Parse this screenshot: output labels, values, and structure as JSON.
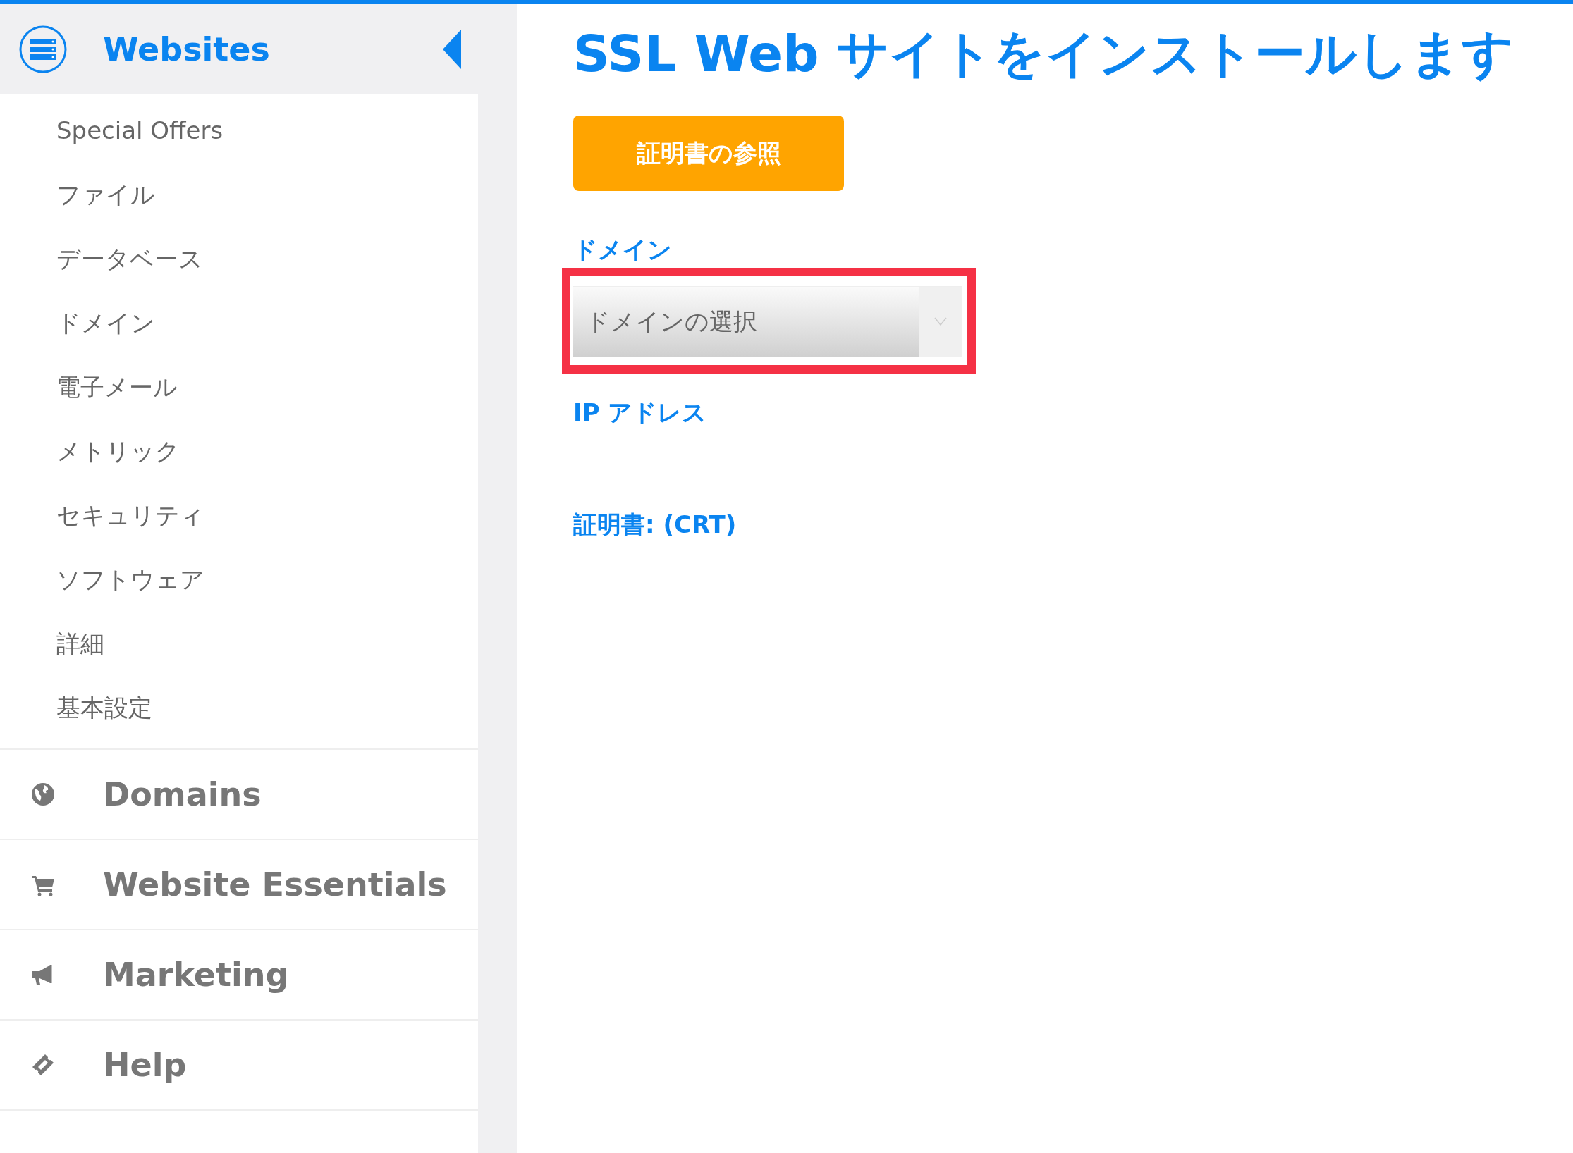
{
  "sidebar": {
    "sections": [
      {
        "label": "Websites",
        "expanded": true,
        "children": [
          "Special Offers",
          "ファイル",
          "データベース",
          "ドメイン",
          "電子メール",
          "メトリック",
          "セキュリティ",
          "ソフトウェア",
          "詳細",
          "基本設定"
        ]
      },
      {
        "label": "Domains",
        "expanded": false
      },
      {
        "label": "Website Essentials",
        "expanded": false
      },
      {
        "label": "Marketing",
        "expanded": false
      },
      {
        "label": "Help",
        "expanded": false
      }
    ]
  },
  "main": {
    "title": "SSL Web サイトをインストールします",
    "browse_button": "証明書の参照",
    "fields": [
      {
        "kind": "select",
        "label": "ドメイン",
        "placeholder": "ドメインの選択",
        "highlighted": true
      },
      {
        "kind": "label",
        "label": "IP アドレス"
      },
      {
        "kind": "label",
        "label": "証明書: (CRT)"
      }
    ]
  }
}
